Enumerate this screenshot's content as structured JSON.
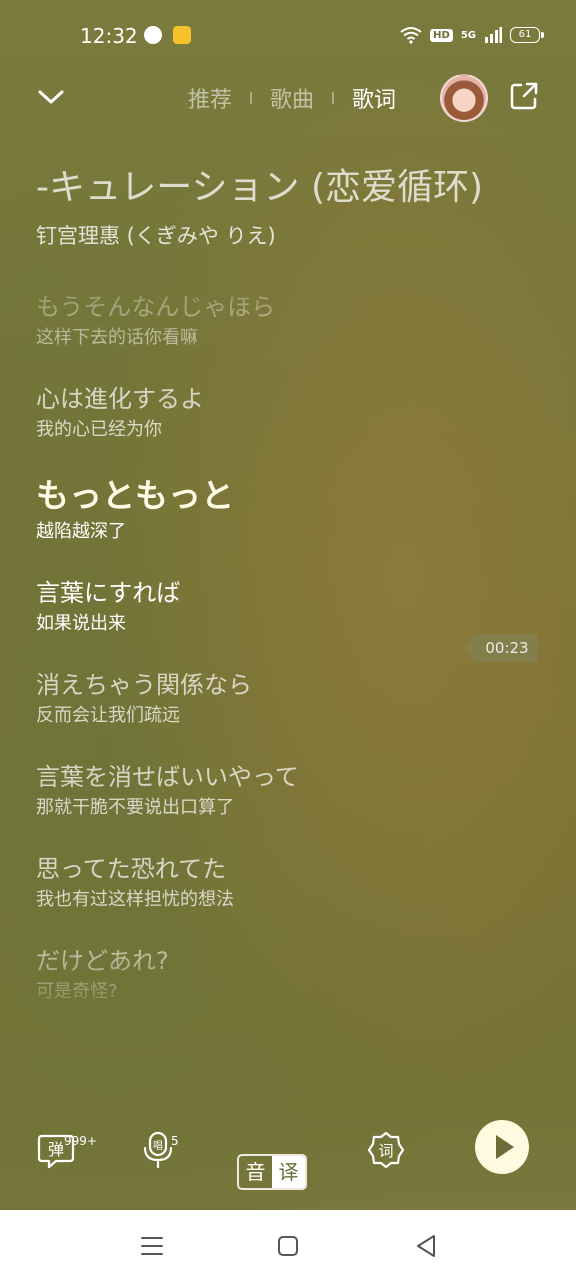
{
  "status_bar": {
    "time": "12:32",
    "hd": "HD",
    "network": "5G",
    "battery": "61"
  },
  "header": {
    "tabs": [
      {
        "label": "推荐",
        "active": false
      },
      {
        "label": "歌曲",
        "active": false
      },
      {
        "label": "歌词",
        "active": true
      }
    ]
  },
  "song": {
    "title": "-キュレーション (恋爱循环)",
    "artist": "钉宫理惠 (くぎみや りえ)"
  },
  "lyrics": [
    {
      "jp": "もうそんなんじゃほら",
      "cn": "这样下去的话你看嘛"
    },
    {
      "jp": "心は進化するよ",
      "cn": "我的心已经为你"
    },
    {
      "jp": "もっともっと",
      "cn": "越陷越深了",
      "state": "current"
    },
    {
      "jp": "言葉にすれば",
      "cn": "如果说出来",
      "state": "next"
    },
    {
      "jp": "消えちゃう関係なら",
      "cn": "反而会让我们疏远"
    },
    {
      "jp": "言葉を消せばいいやって",
      "cn": "那就干脆不要说出口算了"
    },
    {
      "jp": "思ってた恐れてた",
      "cn": "我也有过这样担忧的想法"
    },
    {
      "jp": "だけどあれ?",
      "cn": "可是奇怪?"
    }
  ],
  "seek_time": "00:23",
  "bottom_bar": {
    "danmaku_label": "弹",
    "danmaku_count": "999+",
    "sing_label": "唱",
    "sing_count": "5",
    "toggle_left": "音",
    "toggle_right": "译",
    "lyrics_label": "词"
  }
}
